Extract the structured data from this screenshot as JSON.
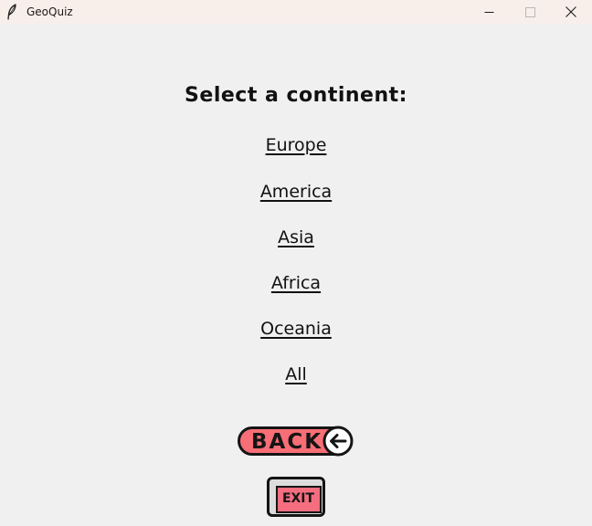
{
  "window": {
    "title": "GeoQuiz",
    "icon": "feather-icon",
    "controls": [
      "minimize-icon",
      "maximize-icon",
      "close-icon"
    ]
  },
  "main": {
    "heading": "Select a continent:",
    "continents": [
      {
        "label": "Europe"
      },
      {
        "label": "America"
      },
      {
        "label": "Asia"
      },
      {
        "label": "Africa"
      },
      {
        "label": "Oceania"
      },
      {
        "label": "All"
      }
    ]
  },
  "buttons": {
    "back_label": "BACK",
    "back_icon": "arrow-left-icon",
    "exit_label": "EXIT"
  },
  "colors": {
    "background": "#f0f0f0",
    "titlebar": "#f8efea",
    "button_fill": "#f76e76",
    "outline": "#151515"
  }
}
